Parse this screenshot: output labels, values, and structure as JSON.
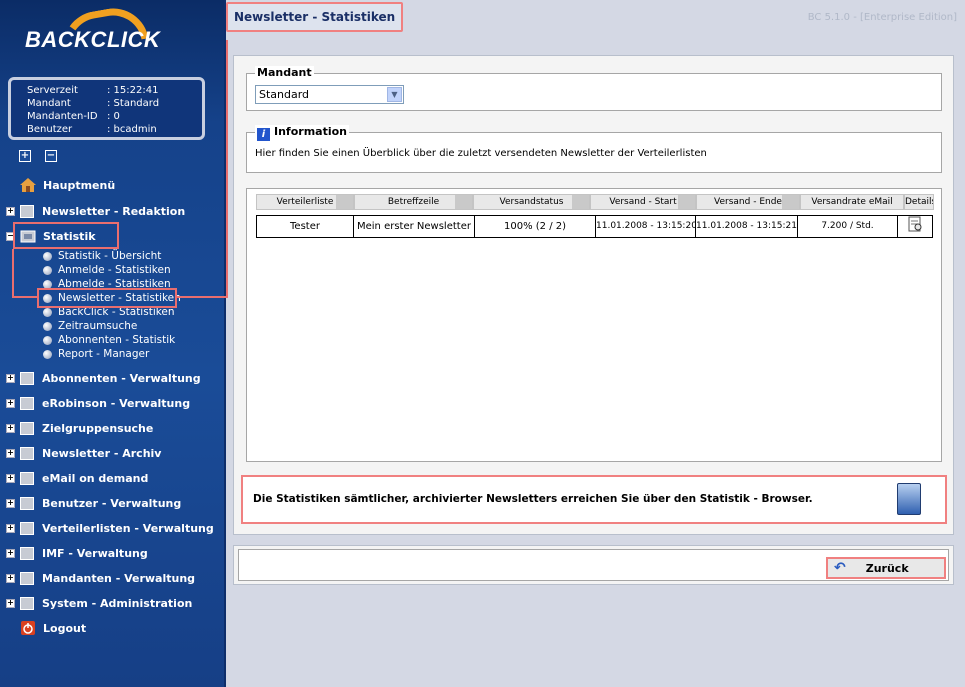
{
  "brand": "BACKCLICK",
  "version": "BC 5.1.0 - [Enterprise Edition]",
  "server_info": {
    "rows": [
      {
        "key": "Serverzeit",
        "value": ": 15:22:41"
      },
      {
        "key": "Mandant",
        "value": ": Standard"
      },
      {
        "key": "Mandanten-ID",
        "value": ": 0"
      },
      {
        "key": "Benutzer",
        "value": ": bcadmin"
      }
    ]
  },
  "nav": {
    "home": "Hauptmenü",
    "newsletter_redaktion": "Newsletter - Redaktion",
    "statistik": "Statistik",
    "statistik_sub": [
      "Statistik - Übersicht",
      "Anmelde - Statistiken",
      "Abmelde - Statistiken",
      "Newsletter - Statistiken",
      "BackClick - Statistiken",
      "Zeitraumsuche",
      "Abonnenten - Statistik",
      "Report - Manager"
    ],
    "items": [
      "Abonnenten - Verwaltung",
      "eRobinson - Verwaltung",
      "Zielgruppensuche",
      "Newsletter - Archiv",
      "eMail on demand",
      "Benutzer - Verwaltung",
      "Verteilerlisten - Verwaltung",
      "IMF - Verwaltung",
      "Mandanten - Verwaltung",
      "System - Administration"
    ],
    "logout": "Logout"
  },
  "page": {
    "title": "Newsletter - Statistiken"
  },
  "mandant": {
    "legend": "Mandant",
    "selected": "Standard"
  },
  "information": {
    "legend": "Information",
    "text": "Hier finden Sie einen Überblick über die zuletzt versendeten Newsletter der Verteilerlisten"
  },
  "table": {
    "headers": [
      "Verteilerliste",
      "Betreffzeile",
      "Versandstatus",
      "Versand - Start",
      "Versand - Ende",
      "Versandrate eMail",
      "Details"
    ],
    "rows": [
      [
        "Tester",
        "Mein erster Newsletter",
        "100% (2 / 2)",
        "11.01.2008 - 13:15:20",
        "11.01.2008 - 13:15:21",
        "7.200 / Std."
      ]
    ]
  },
  "footer_note": "Die Statistiken sämtlicher, archivierter Newsletters erreichen Sie über den Statistik - Browser.",
  "back_button": "Zurück",
  "colors": {
    "sidebar": "#1a4c98",
    "highlight": "#e96e6e",
    "accent": "#f0a020"
  }
}
